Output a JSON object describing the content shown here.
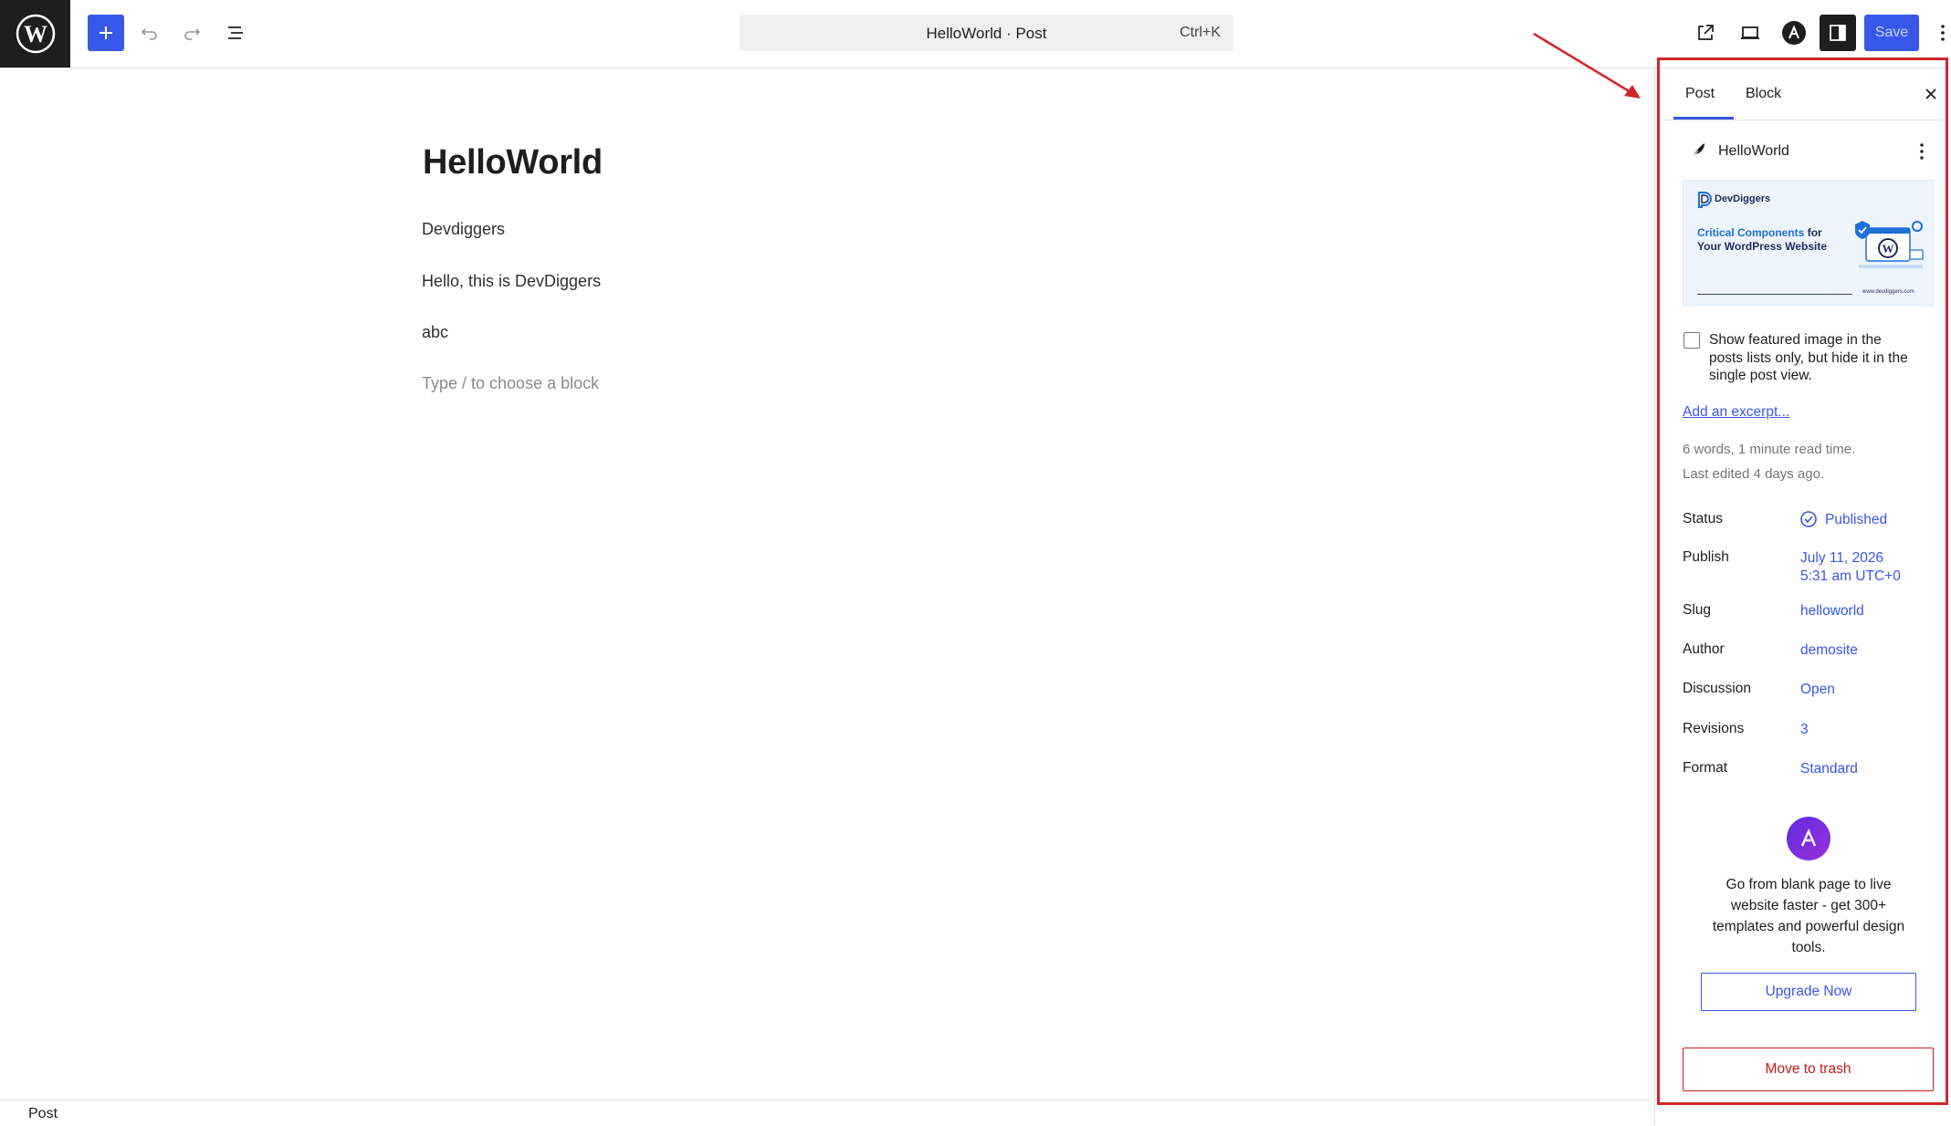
{
  "topbar": {
    "command_bar": {
      "title": "HelloWorld · Post",
      "shortcut": "Ctrl+K"
    },
    "save_label": "Save",
    "icons": [
      "wordpress-logo",
      "plus",
      "undo",
      "redo",
      "list-view",
      "external-link",
      "desktop-preview",
      "astra",
      "sidebar-toggle",
      "more-vertical"
    ]
  },
  "editor": {
    "title": "HelloWorld",
    "paragraphs": [
      "Devdiggers",
      "Hello, this is DevDiggers",
      "abc"
    ],
    "placeholder": "Type / to choose a block"
  },
  "footer": {
    "breadcrumb": "Post"
  },
  "sidebar": {
    "tabs": [
      {
        "label": "Post",
        "active": true
      },
      {
        "label": "Block",
        "active": false
      }
    ],
    "post_title": "HelloWorld",
    "featured_image": {
      "brand": "DevDiggers",
      "headline_highlight": "Critical Components",
      "headline_rest": " for Your WordPress Website",
      "url": "www.devdiggers.com"
    },
    "checkbox": {
      "label": "Show featured image in the posts lists only, but hide it in the single post view.",
      "checked": false
    },
    "excerpt_link": "Add an excerpt...",
    "meta_words": "6 words, 1 minute read time.",
    "meta_edited": "Last edited 4 days ago.",
    "fields": {
      "status": {
        "label": "Status",
        "value": "Published"
      },
      "publish": {
        "label": "Publish",
        "value": "July 11, 2026",
        "value2": "5:31 am UTC+0"
      },
      "slug": {
        "label": "Slug",
        "value": "helloworld"
      },
      "author": {
        "label": "Author",
        "value": "demosite"
      },
      "discussion": {
        "label": "Discussion",
        "value": "Open"
      },
      "revisions": {
        "label": "Revisions",
        "value": "3"
      },
      "format": {
        "label": "Format",
        "value": "Standard"
      }
    },
    "promo": {
      "text": "Go from blank page to live website faster - get 300+ templates and powerful design tools.",
      "button": "Upgrade Now"
    },
    "trash_label": "Move to trash"
  },
  "colors": {
    "accent": "#3858e9",
    "danger": "#cc1818",
    "annotation": "#d1262c",
    "dark": "#1e1e1e"
  }
}
